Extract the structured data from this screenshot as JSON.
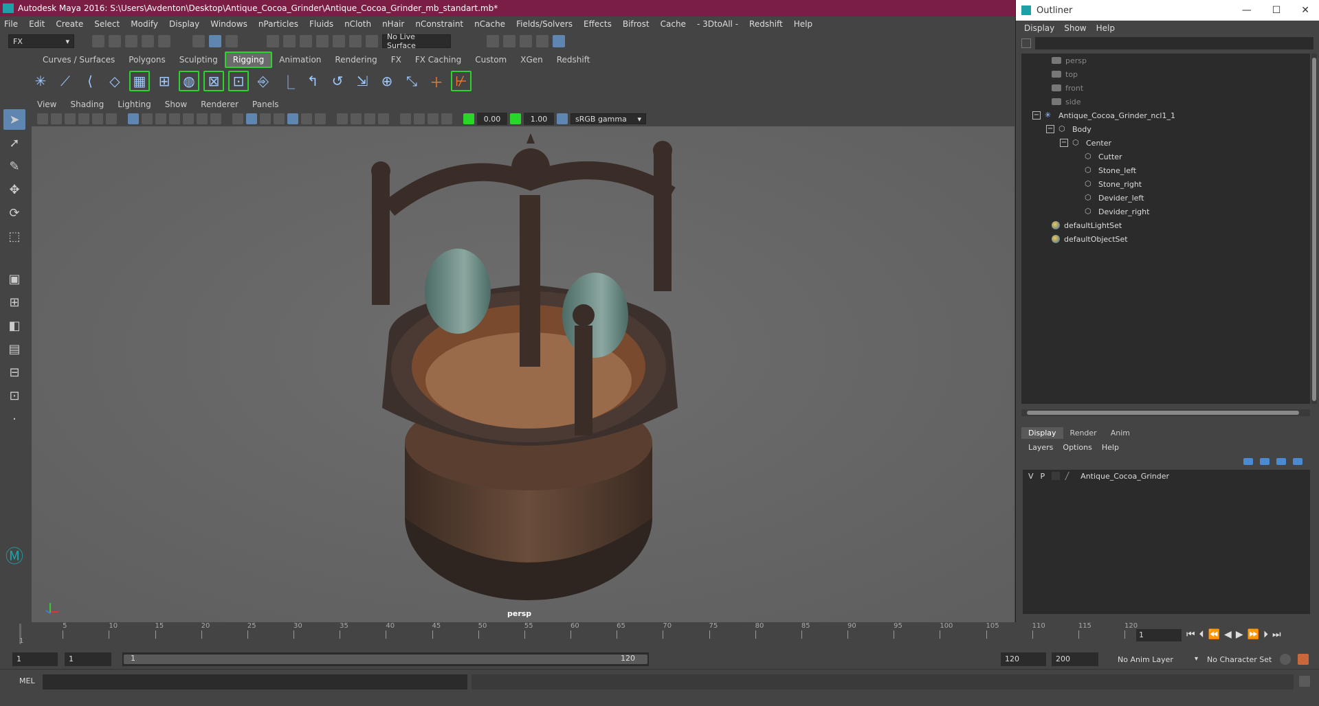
{
  "window": {
    "title": "Autodesk Maya 2016: S:\\Users\\Avdenton\\Desktop\\Antique_Cocoa_Grinder\\Antique_Cocoa_Grinder_mb_standart.mb*"
  },
  "menubar": [
    "File",
    "Edit",
    "Create",
    "Select",
    "Modify",
    "Display",
    "Windows",
    "nParticles",
    "Fluids",
    "nCloth",
    "nHair",
    "nConstraint",
    "nCache",
    "Fields/Solvers",
    "Effects",
    "Bifrost",
    "Cache",
    "- 3DtoAll -",
    "Redshift",
    "Help"
  ],
  "statusline": {
    "menuset": "FX",
    "live_surface": "No Live Surface"
  },
  "shelf_tabs": [
    "Curves / Surfaces",
    "Polygons",
    "Sculpting",
    "Rigging",
    "Animation",
    "Rendering",
    "FX",
    "FX Caching",
    "Custom",
    "XGen",
    "Redshift"
  ],
  "shelf_active": "Rigging",
  "viewport": {
    "menu": [
      "View",
      "Shading",
      "Lighting",
      "Show",
      "Renderer",
      "Panels"
    ],
    "exposure": "0.00",
    "gamma": "1.00",
    "color_space": "sRGB gamma",
    "camera_label": "persp"
  },
  "outliner": {
    "title": "Outliner",
    "menu": [
      "Display",
      "Show",
      "Help"
    ],
    "items": [
      {
        "label": "persp"
      },
      {
        "label": "top"
      },
      {
        "label": "front"
      },
      {
        "label": "side"
      },
      {
        "label": "Antique_Cocoa_Grinder_ncl1_1"
      },
      {
        "label": "Body"
      },
      {
        "label": "Center"
      },
      {
        "label": "Cutter"
      },
      {
        "label": "Stone_left"
      },
      {
        "label": "Stone_right"
      },
      {
        "label": "Devider_left"
      },
      {
        "label": "Devider_right"
      },
      {
        "label": "defaultLightSet"
      },
      {
        "label": "defaultObjectSet"
      }
    ]
  },
  "layer_editor": {
    "tabs": [
      "Display",
      "Render",
      "Anim"
    ],
    "active_tab": "Display",
    "menu": [
      "Layers",
      "Options",
      "Help"
    ],
    "layer": {
      "v": "V",
      "p": "P",
      "name": "Antique_Cocoa_Grinder"
    }
  },
  "timeline": {
    "ticks": [
      "5",
      "10",
      "15",
      "20",
      "25",
      "30",
      "35",
      "40",
      "45",
      "50",
      "55",
      "60",
      "65",
      "70",
      "75",
      "80",
      "85",
      "90",
      "95",
      "100",
      "105",
      "110",
      "115",
      "120"
    ],
    "start_label": "1",
    "current_frame": "1"
  },
  "range": {
    "start": "1",
    "start_inner": "1",
    "bar_start": "1",
    "bar_end": "120",
    "end_inner": "120",
    "end": "200",
    "anim_layer": "No Anim Layer",
    "char_set": "No Character Set"
  },
  "cmdline": {
    "label": "MEL"
  }
}
